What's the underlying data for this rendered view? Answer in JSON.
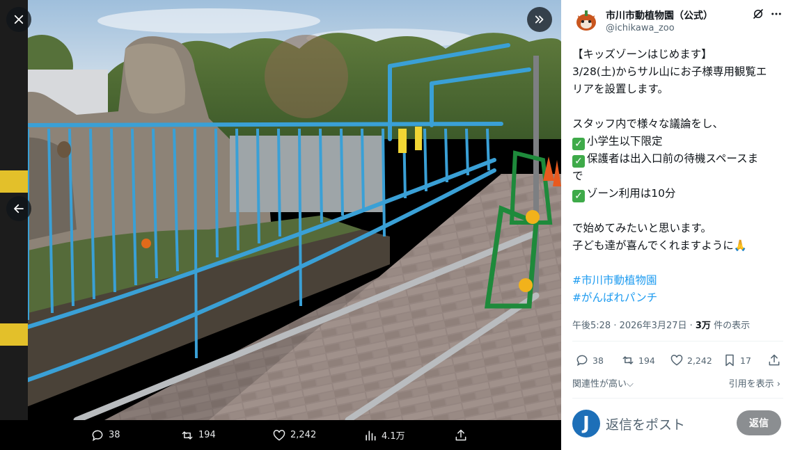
{
  "media": {
    "photo_description_icon": "photo",
    "actions": {
      "replies": "38",
      "reposts": "194",
      "likes": "2,242",
      "views": "4.1万"
    }
  },
  "tweet": {
    "author_name": "市川市動植物園（公式）",
    "author_handle": "@ichikawa_zoo",
    "lines": [
      {
        "text": "【キッズゾーンはじめます】"
      },
      {
        "text": "3/28(土)からサル山にお子様専用観覧エ"
      },
      {
        "text": "リアを設置します。"
      },
      {
        "text": ""
      },
      {
        "text": "スタッフ内で様々な議論をし、"
      },
      {
        "text": "小学生以下限定",
        "check": true
      },
      {
        "text": "保護者は出入口前の待機スペースま",
        "check": true
      },
      {
        "text": "で"
      },
      {
        "text": "ゾーン利用は10分",
        "check": true
      },
      {
        "text": ""
      },
      {
        "text": "で始めてみたいと思います。"
      },
      {
        "text": "子ども達が喜んでくれますように🙏"
      },
      {
        "text": ""
      },
      {
        "text": "#市川市動植物園",
        "hashtag": true
      },
      {
        "text": "#がんばれパンチ",
        "hashtag": true
      }
    ],
    "meta_time": "午後5:28 · 2026年3月27日 · ",
    "meta_views": "3万",
    "meta_views_suffix": " 件の表示",
    "stats": {
      "replies": "38",
      "reposts": "194",
      "likes": "2,242",
      "bookmarks": "17"
    },
    "sort_label": "関連性が高い",
    "quotes_label": "引用を表示"
  },
  "reply": {
    "avatar_letter": "J",
    "placeholder": "返信をポスト",
    "button_label": "返信"
  },
  "colors": {
    "accent": "#1d9bf0",
    "fence": "#3aa0d6",
    "check": "#3eaa49"
  }
}
